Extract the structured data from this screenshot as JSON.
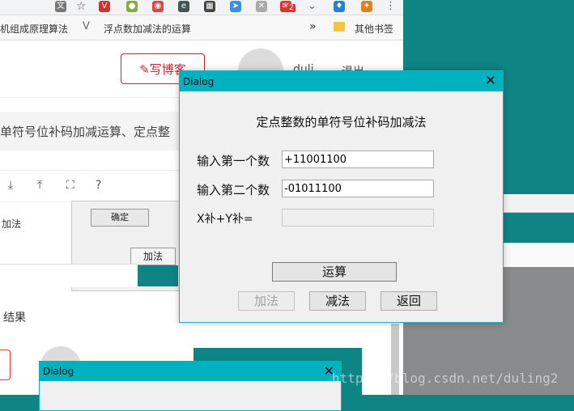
{
  "browser": {
    "bookmarks": [
      {
        "label": "机组成原理算法"
      },
      {
        "label": "浮点数加减法的运算"
      }
    ],
    "overflow": "»",
    "other_bookmarks": "其他书签",
    "notification_count": "2"
  },
  "page": {
    "write_button": "写博客",
    "user_fragment": "duli",
    "logout_fragment": "退出",
    "article_title": "单符号位补码加减运算、定点整",
    "add_label": "加法",
    "result_heading": "结果",
    "embedded_ok": "确定",
    "embedded_add": "加法"
  },
  "dialog": {
    "title": "Dialog",
    "close_glyph": "✕",
    "heading": "定点整数的单符号位补码加减法",
    "first_label": "输入第一个数",
    "first_value": "+11001100",
    "second_label": "输入第二个数",
    "second_value": "-01011100",
    "result_label": "X补+Y补=",
    "result_value": "",
    "compute_button": "运算",
    "add_button": "加法",
    "subtract_button": "减法",
    "back_button": "返回"
  },
  "dialog2": {
    "title": "Dialog",
    "close_glyph": "✕"
  },
  "watermark": "https://blog.csdn.net/duling2",
  "colors": {
    "teal": "#0f8484",
    "dialog_titlebar": "#00b2c0",
    "brand_red": "#c3292f"
  }
}
